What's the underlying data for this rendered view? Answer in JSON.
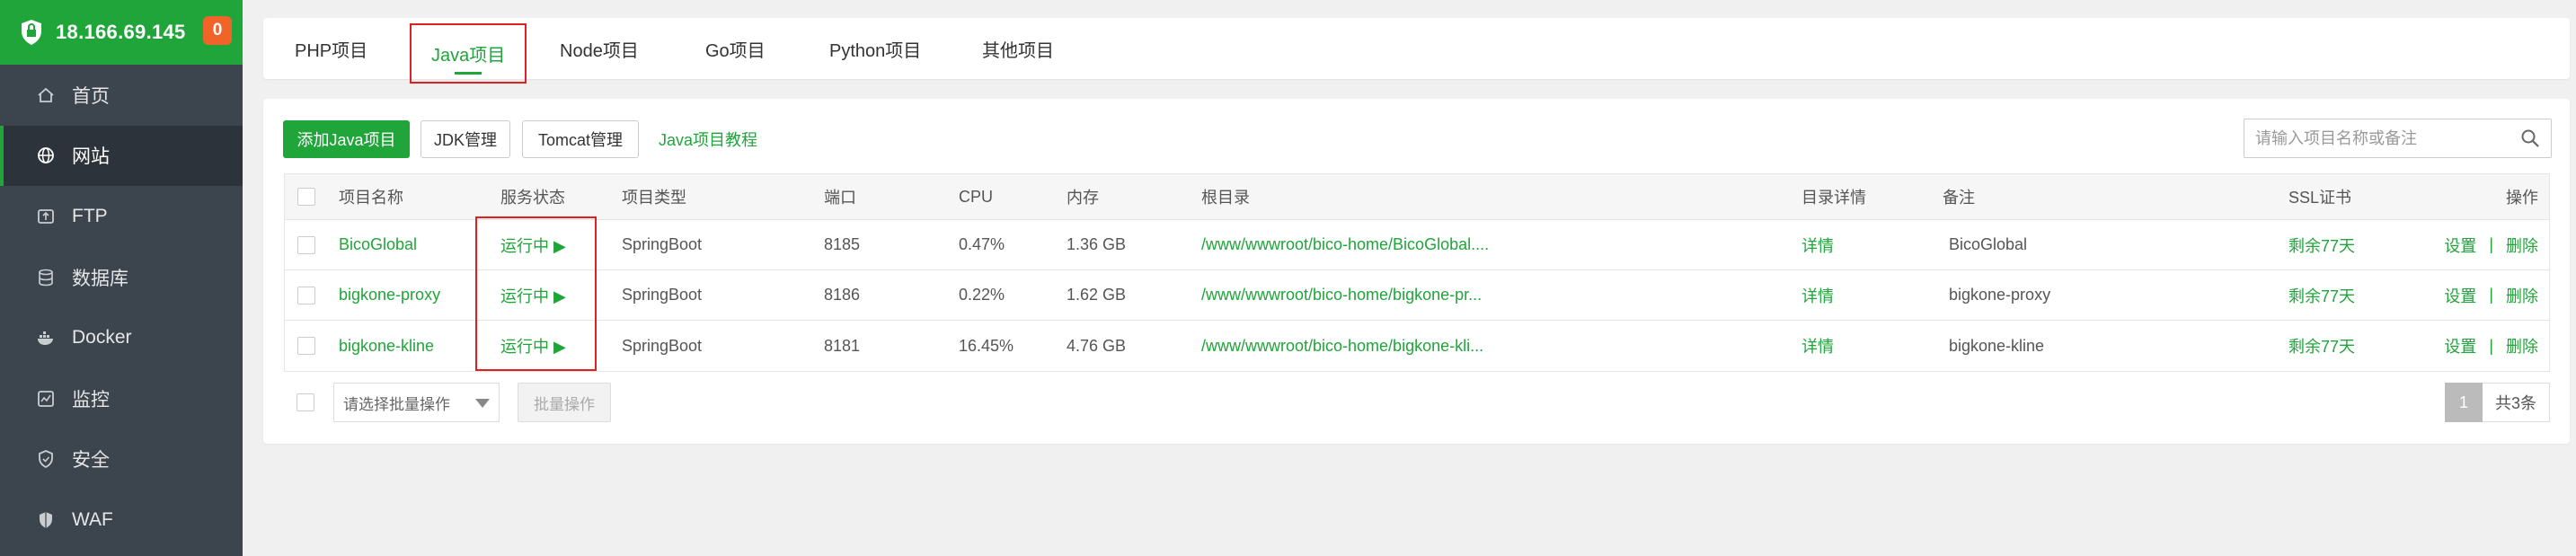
{
  "sidebar": {
    "ip": "18.166.69.145",
    "badge": "0",
    "items": [
      {
        "label": "首页",
        "icon": "home-icon"
      },
      {
        "label": "网站",
        "icon": "globe-icon",
        "active": true
      },
      {
        "label": "FTP",
        "icon": "ftp-icon"
      },
      {
        "label": "数据库",
        "icon": "database-icon"
      },
      {
        "label": "Docker",
        "icon": "docker-icon"
      },
      {
        "label": "监控",
        "icon": "monitor-icon"
      },
      {
        "label": "安全",
        "icon": "security-icon"
      },
      {
        "label": "WAF",
        "icon": "waf-shield-icon"
      }
    ]
  },
  "tabs": [
    {
      "label": "PHP项目"
    },
    {
      "label": "Java项目",
      "active": true
    },
    {
      "label": "Node项目"
    },
    {
      "label": "Go项目"
    },
    {
      "label": "Python项目"
    },
    {
      "label": "其他项目"
    }
  ],
  "toolbar": {
    "add_label": "添加Java项目",
    "jdk_label": "JDK管理",
    "tomcat_label": "Tomcat管理",
    "tutorial_label": "Java项目教程",
    "search_placeholder": "请输入项目名称或备注"
  },
  "table": {
    "headers": {
      "name": "项目名称",
      "status": "服务状态",
      "type": "项目类型",
      "port": "端口",
      "cpu": "CPU",
      "mem": "内存",
      "root": "根目录",
      "detail": "目录详情",
      "remark": "备注",
      "ssl": "SSL证书",
      "ops": "操作"
    },
    "rows": [
      {
        "name": "BicoGlobal",
        "status": "运行中 ▶",
        "type": "SpringBoot",
        "port": "8185",
        "cpu": "0.47%",
        "mem": "1.36 GB",
        "root": "/www/wwwroot/bico-home/BicoGlobal....",
        "detail": "详情",
        "remark": "BicoGlobal",
        "ssl": "剩余77天",
        "set": "设置",
        "sep": "|",
        "del": "删除"
      },
      {
        "name": "bigkone-proxy",
        "status": "运行中 ▶",
        "type": "SpringBoot",
        "port": "8186",
        "cpu": "0.22%",
        "mem": "1.62 GB",
        "root": "/www/wwwroot/bico-home/bigkone-pr...",
        "detail": "详情",
        "remark": "bigkone-proxy",
        "ssl": "剩余77天",
        "set": "设置",
        "sep": "|",
        "del": "删除"
      },
      {
        "name": "bigkone-kline",
        "status": "运行中 ▶",
        "type": "SpringBoot",
        "port": "8181",
        "cpu": "16.45%",
        "mem": "4.76 GB",
        "root": "/www/wwwroot/bico-home/bigkone-kli...",
        "detail": "详情",
        "remark": "bigkone-kline",
        "ssl": "剩余77天",
        "set": "设置",
        "sep": "|",
        "del": "删除"
      }
    ]
  },
  "footer": {
    "batch_placeholder": "请选择批量操作",
    "batch_button": "批量操作",
    "page": "1",
    "total": "共3条"
  },
  "colors": {
    "accent": "#20a53a",
    "highlight": "#e02020",
    "badge": "#f0642a",
    "sidebar": "#3c444d"
  }
}
